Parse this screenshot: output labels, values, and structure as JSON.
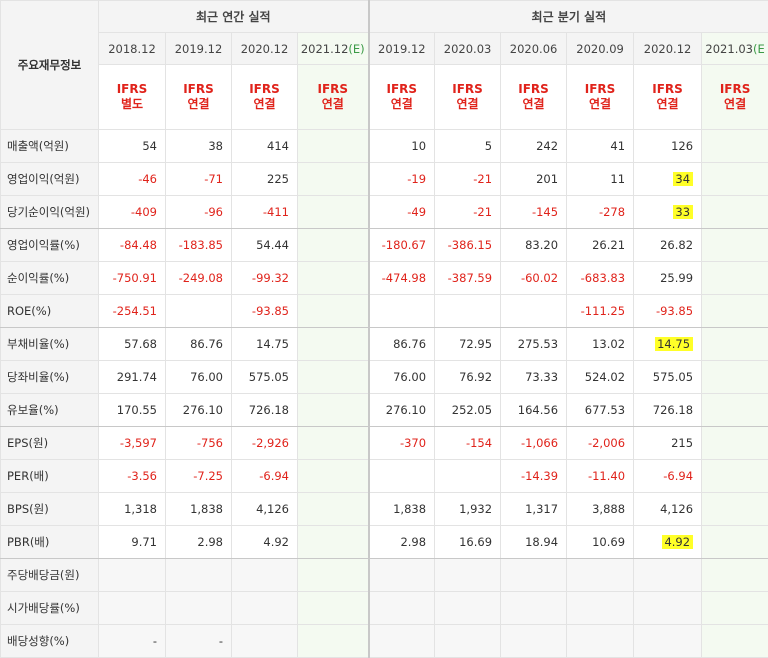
{
  "header": {
    "label": "주요재무정보",
    "annual_title": "최근 연간 실적",
    "quarter_title": "최근 분기 실적",
    "annual_periods": [
      "2018.12",
      "2019.12",
      "2020.12",
      "2021.12"
    ],
    "annual_est_suffix": "(E)",
    "quarter_periods": [
      "2019.12",
      "2020.03",
      "2020.06",
      "2020.09",
      "2020.12",
      "2021.03"
    ],
    "quarter_est_suffix": "(E",
    "annual_ifrs": [
      [
        "IFRS",
        "별도"
      ],
      [
        "IFRS",
        "연결"
      ],
      [
        "IFRS",
        "연결"
      ],
      [
        "IFRS",
        "연결"
      ]
    ],
    "quarter_ifrs": [
      [
        "IFRS",
        "연결"
      ],
      [
        "IFRS",
        "연결"
      ],
      [
        "IFRS",
        "연결"
      ],
      [
        "IFRS",
        "연결"
      ],
      [
        "IFRS",
        "연결"
      ],
      [
        "IFRS",
        "연결"
      ]
    ]
  },
  "rows": [
    {
      "label": "매출액(억원)",
      "annual": [
        "54",
        "38",
        "414",
        ""
      ],
      "quarter": [
        "10",
        "5",
        "242",
        "41",
        "126",
        ""
      ]
    },
    {
      "label": "영업이익(억원)",
      "annual": [
        "-46",
        "-71",
        "225",
        ""
      ],
      "quarter": [
        "-19",
        "-21",
        "201",
        "11",
        "34",
        ""
      ]
    },
    {
      "label": "당기순이익(억원)",
      "annual": [
        "-409",
        "-96",
        "-411",
        ""
      ],
      "quarter": [
        "-49",
        "-21",
        "-145",
        "-278",
        "33",
        ""
      ]
    },
    {
      "label": "영업이익률(%)",
      "annual": [
        "-84.48",
        "-183.85",
        "54.44",
        ""
      ],
      "quarter": [
        "-180.67",
        "-386.15",
        "83.20",
        "26.21",
        "26.82",
        ""
      ]
    },
    {
      "label": "순이익률(%)",
      "annual": [
        "-750.91",
        "-249.08",
        "-99.32",
        ""
      ],
      "quarter": [
        "-474.98",
        "-387.59",
        "-60.02",
        "-683.83",
        "25.99",
        ""
      ]
    },
    {
      "label": "ROE(%)",
      "annual": [
        "-254.51",
        "",
        "-93.85",
        ""
      ],
      "quarter": [
        "",
        "",
        "",
        "-111.25",
        "-93.85",
        ""
      ]
    },
    {
      "label": "부채비율(%)",
      "annual": [
        "57.68",
        "86.76",
        "14.75",
        ""
      ],
      "quarter": [
        "86.76",
        "72.95",
        "275.53",
        "13.02",
        "14.75",
        ""
      ]
    },
    {
      "label": "당좌비율(%)",
      "annual": [
        "291.74",
        "76.00",
        "575.05",
        ""
      ],
      "quarter": [
        "76.00",
        "76.92",
        "73.33",
        "524.02",
        "575.05",
        ""
      ]
    },
    {
      "label": "유보율(%)",
      "annual": [
        "170.55",
        "276.10",
        "726.18",
        ""
      ],
      "quarter": [
        "276.10",
        "252.05",
        "164.56",
        "677.53",
        "726.18",
        ""
      ]
    },
    {
      "label": "EPS(원)",
      "annual": [
        "-3,597",
        "-756",
        "-2,926",
        ""
      ],
      "quarter": [
        "-370",
        "-154",
        "-1,066",
        "-2,006",
        "215",
        ""
      ]
    },
    {
      "label": "PER(배)",
      "annual": [
        "-3.56",
        "-7.25",
        "-6.94",
        ""
      ],
      "quarter": [
        "",
        "",
        "-14.39",
        "-11.40",
        "-6.94",
        ""
      ]
    },
    {
      "label": "BPS(원)",
      "annual": [
        "1,318",
        "1,838",
        "4,126",
        ""
      ],
      "quarter": [
        "1,838",
        "1,932",
        "1,317",
        "3,888",
        "4,126",
        ""
      ]
    },
    {
      "label": "PBR(배)",
      "annual": [
        "9.71",
        "2.98",
        "4.92",
        ""
      ],
      "quarter": [
        "2.98",
        "16.69",
        "18.94",
        "10.69",
        "4.92",
        ""
      ]
    },
    {
      "label": "주당배당금(원)",
      "annual": [
        "",
        "",
        "",
        ""
      ],
      "quarter": [
        "",
        "",
        "",
        "",
        "",
        ""
      ]
    },
    {
      "label": "시가배당률(%)",
      "annual": [
        "",
        "",
        "",
        ""
      ],
      "quarter": [
        "",
        "",
        "",
        "",
        "",
        ""
      ]
    },
    {
      "label": "배당성향(%)",
      "annual": [
        "-",
        "-",
        "",
        ""
      ],
      "quarter": [
        "",
        "",
        "",
        "",
        "",
        ""
      ]
    }
  ],
  "highlight_color": "#ffff28",
  "negative_color": "#e0231b",
  "estimate_color": "#3b9a46"
}
